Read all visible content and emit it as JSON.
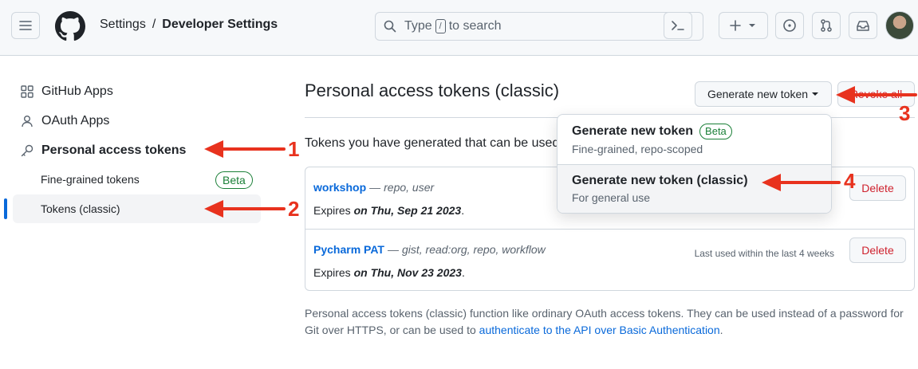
{
  "header": {
    "breadcrumb": [
      "Settings",
      "/",
      "Developer Settings"
    ],
    "search": {
      "prefix": "Type",
      "key": "/",
      "suffix": "to search"
    }
  },
  "sidebar": {
    "items": [
      {
        "label": "GitHub Apps",
        "icon": "apps-icon"
      },
      {
        "label": "OAuth Apps",
        "icon": "person-icon"
      },
      {
        "label": "Personal access tokens",
        "icon": "key-icon"
      }
    ],
    "sub_items": [
      {
        "label": "Fine-grained tokens",
        "badge": "Beta"
      },
      {
        "label": "Tokens (classic)",
        "active": true
      }
    ]
  },
  "main": {
    "title": "Personal access tokens (classic)",
    "generate_button": "Generate new token",
    "revoke_button": "Revoke all",
    "intro": "Tokens you have generated that can be used to access the GitHub API.",
    "tokens": [
      {
        "name": "workshop",
        "scopes": "repo, user",
        "expires_prefix": "Expires",
        "expires": "on Thu, Sep 21 2023",
        "last_used": "",
        "delete": "Delete"
      },
      {
        "name": "Pycharm PAT",
        "scopes": "gist, read:org, repo, workflow",
        "expires_prefix": "Expires",
        "expires": "on Thu, Nov 23 2023",
        "last_used": "Last used within the last 4 weeks",
        "delete": "Delete"
      }
    ],
    "footer_text": "Personal access tokens (classic) function like ordinary OAuth access tokens. They can be used instead of a password for Git over HTTPS, or can be used to",
    "footer_link": "authenticate to the API over Basic Authentication",
    "footer_end": "."
  },
  "dropdown": {
    "items": [
      {
        "title": "Generate new token",
        "badge": "Beta",
        "desc": "Fine-grained, repo-scoped"
      },
      {
        "title": "Generate new token (classic)",
        "desc": "For general use"
      }
    ]
  },
  "annotations": [
    "1",
    "2",
    "3",
    "4"
  ],
  "colors": {
    "accent": "#0969da",
    "danger": "#cf222e",
    "success": "#1a7f37",
    "annotation": "#e8321e"
  }
}
